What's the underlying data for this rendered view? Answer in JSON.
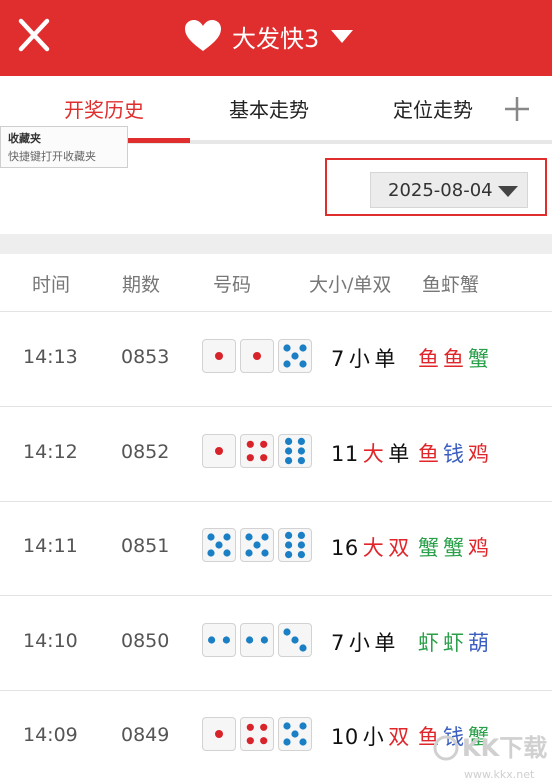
{
  "header": {
    "title": "大发快3"
  },
  "tabs": [
    {
      "label": "开奖历史",
      "active": true
    },
    {
      "label": "基本走势",
      "active": false
    },
    {
      "label": "定位走势",
      "active": false
    }
  ],
  "tooltip": {
    "title": "收藏夹",
    "subtitle": "快捷键打开收藏夹"
  },
  "date_select": {
    "value": "2025-08-04"
  },
  "columns": [
    "时间",
    "期数",
    "号码",
    "大小/单双",
    "鱼虾蟹"
  ],
  "rows": [
    {
      "time": "14:13",
      "issue": "0853",
      "dice": [
        1,
        1,
        5
      ],
      "sum": "7",
      "size": "小",
      "parity": "单",
      "fish": [
        "鱼",
        "鱼",
        "蟹"
      ]
    },
    {
      "time": "14:12",
      "issue": "0852",
      "dice": [
        1,
        4,
        6
      ],
      "sum": "11",
      "size": "大",
      "parity": "单",
      "fish": [
        "鱼",
        "钱",
        "鸡"
      ]
    },
    {
      "time": "14:11",
      "issue": "0851",
      "dice": [
        5,
        5,
        6
      ],
      "sum": "16",
      "size": "大",
      "parity": "双",
      "fish": [
        "蟹",
        "蟹",
        "鸡"
      ]
    },
    {
      "time": "14:10",
      "issue": "0850",
      "dice": [
        2,
        2,
        3
      ],
      "sum": "7",
      "size": "小",
      "parity": "单",
      "fish": [
        "虾",
        "虾",
        "葫"
      ]
    },
    {
      "time": "14:09",
      "issue": "0849",
      "dice": [
        1,
        4,
        5
      ],
      "sum": "10",
      "size": "小",
      "parity": "双",
      "fish": [
        "鱼",
        "钱",
        "蟹"
      ]
    }
  ],
  "watermark": {
    "text": "KK下载",
    "url": "www.kkx.net"
  },
  "colors": {
    "brand_red": "#e02e2e",
    "die_red": "#d8232a",
    "die_blue": "#1a7fc4",
    "fish_red": "#e0262a",
    "fish_green": "#2aa04a",
    "fish_blue": "#3b5fc0"
  }
}
